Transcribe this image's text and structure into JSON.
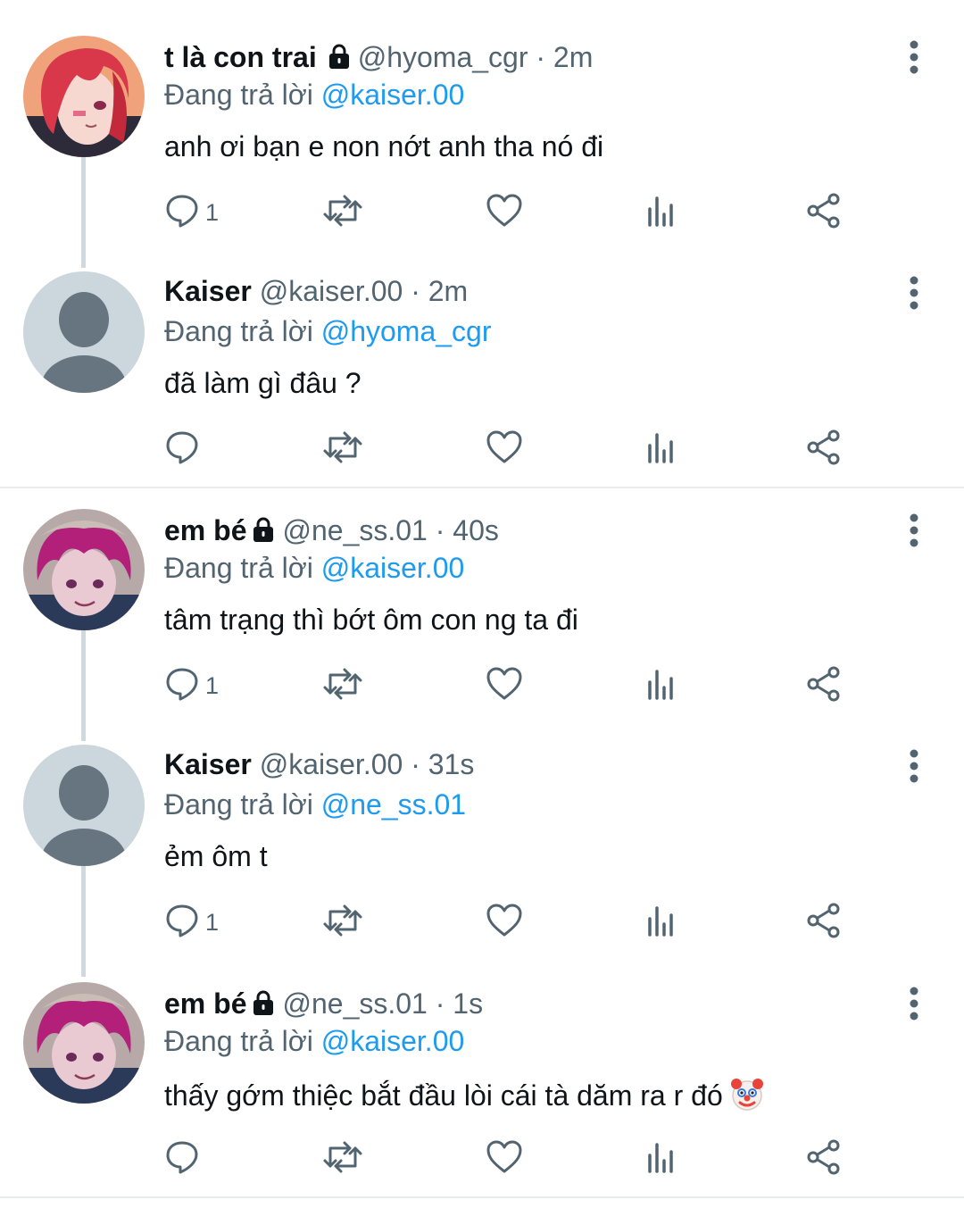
{
  "colors": {
    "link": "#1d9bf0",
    "secondary": "#536471",
    "text": "#0f1419",
    "thread_line": "#cfd9de"
  },
  "tweets": [
    {
      "name": "t là con trai",
      "locked": true,
      "handle": "@hyoma_cgr",
      "time": "2m",
      "reply_prefix": "Đang trả lời",
      "reply_to": "@kaiser.00",
      "text": "anh ơi bạn e non nớt anh tha nó đi",
      "reply_count": "1",
      "avatar": "red-hair-anime-avatar"
    },
    {
      "name": "Kaiser",
      "locked": false,
      "handle": "@kaiser.00",
      "time": "2m",
      "reply_prefix": "Đang trả lời",
      "reply_to": "@hyoma_cgr",
      "text": "đã làm gì đâu ?",
      "reply_count": "",
      "avatar": "default-avatar"
    },
    {
      "name": "em bé",
      "locked": true,
      "handle": "@ne_ss.01",
      "time": "40s",
      "reply_prefix": "Đang trả lời",
      "reply_to": "@kaiser.00",
      "text": "tâm trạng thì bớt ôm con ng ta đi",
      "reply_count": "1",
      "avatar": "pink-hair-anime-avatar"
    },
    {
      "name": "Kaiser",
      "locked": false,
      "handle": "@kaiser.00",
      "time": "31s",
      "reply_prefix": "Đang trả lời",
      "reply_to": "@ne_ss.01",
      "text": "ẻm ôm t",
      "reply_count": "1",
      "avatar": "default-avatar"
    },
    {
      "name": "em bé",
      "locked": true,
      "handle": "@ne_ss.01",
      "time": "1s",
      "reply_prefix": "Đang trả lời",
      "reply_to": "@kaiser.00",
      "text": "thấy gớm thiệc bắt đầu lòi cái tà dăm ra r đó",
      "reply_count": "",
      "avatar": "pink-hair-anime-avatar",
      "trailing_emoji": "clown-face-emoji"
    }
  ]
}
